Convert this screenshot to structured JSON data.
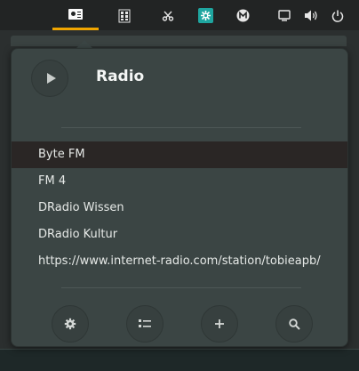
{
  "top_panel": {
    "indicators": [
      {
        "name": "radio-indicator",
        "active": true
      },
      {
        "name": "apps-grid-icon"
      },
      {
        "name": "scissors-icon"
      },
      {
        "name": "app-icon-teal"
      },
      {
        "name": "m-badge-icon"
      },
      {
        "name": "screen-icon"
      },
      {
        "name": "volume-icon"
      },
      {
        "name": "power-icon"
      }
    ],
    "accent_color": "#f0a500"
  },
  "popup": {
    "title": "Radio",
    "stations": [
      {
        "label": "Byte FM",
        "selected": true
      },
      {
        "label": "FM 4",
        "selected": false
      },
      {
        "label": "DRadio Wissen",
        "selected": false
      },
      {
        "label": "DRadio Kultur",
        "selected": false
      },
      {
        "label": "https://www.internet-radio.com/station/tobieapb/",
        "selected": false
      }
    ],
    "actions": [
      {
        "name": "settings-button",
        "icon": "gear-icon"
      },
      {
        "name": "list-button",
        "icon": "list-icon"
      },
      {
        "name": "add-button",
        "icon": "plus-icon"
      },
      {
        "name": "search-button",
        "icon": "search-icon"
      }
    ]
  }
}
